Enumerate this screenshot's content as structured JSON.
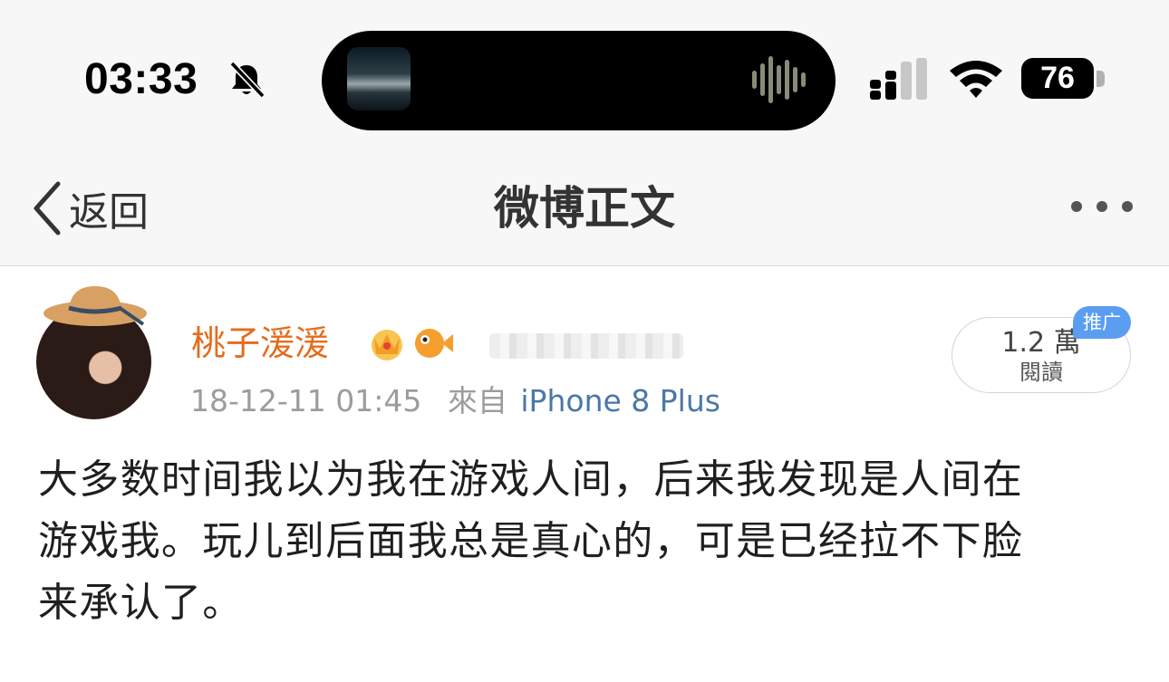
{
  "status_bar": {
    "time": "03:33",
    "icons": [
      "bell-slash-icon",
      "music-waveform-icon",
      "cellular-signal-icon",
      "wifi-icon",
      "battery-icon"
    ],
    "battery": "76"
  },
  "nav": {
    "back_label": "返回",
    "title": "微博正文"
  },
  "post": {
    "author": "桃子湲湲",
    "timestamp": "18-12-11 01:45",
    "source_prefix": "來自",
    "source_device": "iPhone 8 Plus",
    "reads_count": "1.2 萬",
    "reads_label": "閱讀",
    "promo_badge": "推广",
    "lines": [
      "大多数时间我以为我在游戏人间，后来我发现是人间在",
      "游戏我。玩儿到后面我总是真心的，可是已经拉不下脸",
      "来承认了。"
    ]
  },
  "colors": {
    "username": "#e46c1c",
    "device_link": "#4a78a8",
    "promo_badge": "#5b9ef0"
  }
}
